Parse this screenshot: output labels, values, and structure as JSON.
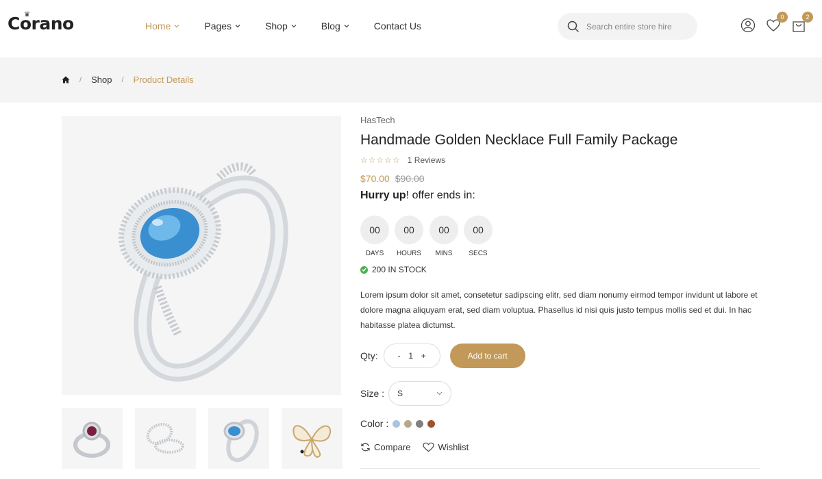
{
  "header": {
    "logo": "Corano",
    "nav": [
      {
        "label": "Home",
        "active": true,
        "dropdown": true
      },
      {
        "label": "Pages",
        "active": false,
        "dropdown": true
      },
      {
        "label": "Shop",
        "active": false,
        "dropdown": true
      },
      {
        "label": "Blog",
        "active": false,
        "dropdown": true
      },
      {
        "label": "Contact Us",
        "active": false,
        "dropdown": false
      }
    ],
    "search_placeholder": "Search entire store hire",
    "wishlist_count": "0",
    "cart_count": "2",
    "icons": [
      "search-icon",
      "user-icon",
      "heart-icon",
      "bag-icon"
    ]
  },
  "breadcrumb": {
    "home_icon": "home-icon",
    "shop": "Shop",
    "current": "Product Details"
  },
  "product": {
    "brand": "HasTech",
    "title": "Handmade Golden Necklace Full Family Package",
    "rating_stars": 0,
    "reviews": "1 Reviews",
    "price_new": "$70.00",
    "price_old": "$90.00",
    "offer_bold": "Hurry up",
    "offer_rest": "! offer ends in:",
    "countdown": [
      {
        "value": "00",
        "label": "DAYS"
      },
      {
        "value": "00",
        "label": "HOURS"
      },
      {
        "value": "00",
        "label": "MINS"
      },
      {
        "value": "00",
        "label": "SECS"
      }
    ],
    "stock": "200 IN STOCK",
    "description": "Lorem ipsum dolor sit amet, consetetur sadipscing elitr, sed diam nonumy eirmod tempor invidunt ut labore et dolore magna aliquyam erat, sed diam voluptua. Phasellus id nisi quis justo tempus mollis sed et dui. In hac habitasse platea dictumst.",
    "qty_label": "Qty:",
    "qty_minus": "-",
    "qty_value": "1",
    "qty_plus": "+",
    "add_to_cart": "Add to cart",
    "size_label": "Size :",
    "size_value": "S",
    "color_label": "Color :",
    "colors": [
      "#a8c4e0",
      "#b8a88a",
      "#808080",
      "#a0522d"
    ],
    "compare": "Compare",
    "wishlist": "Wishlist"
  },
  "theme": {
    "accent": "#c29958"
  }
}
